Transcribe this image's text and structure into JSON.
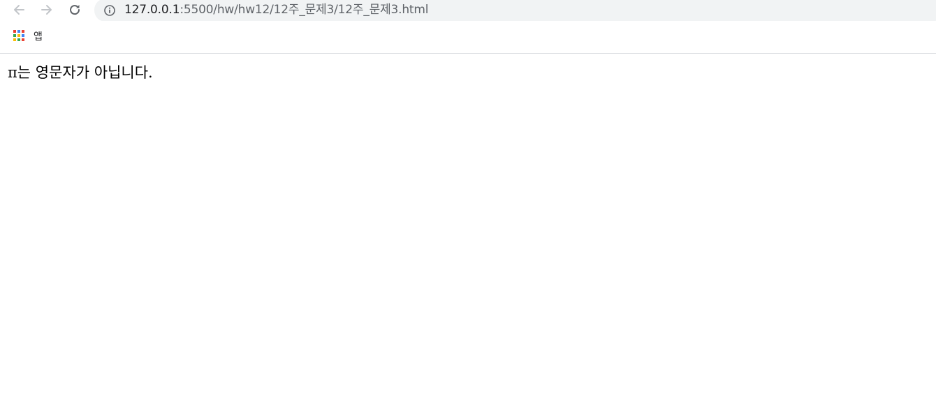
{
  "browser": {
    "back_icon": "arrow-left-icon",
    "forward_icon": "arrow-right-icon",
    "reload_icon": "reload-icon",
    "address": {
      "info_icon": "info-icon",
      "host": "127.0.0.1",
      "path": ":5500/hw/hw12/12주_문제3/12주_문제3.html"
    },
    "bookmarks": {
      "apps_icon": "apps-grid-icon",
      "apps_label": "앱"
    },
    "colors": {
      "omnibox_bg": "#f1f3f4",
      "icon_gray": "#5f6368",
      "icon_light": "#c2c5c9"
    }
  },
  "page": {
    "message": "π는 영문자가 아닙니다."
  }
}
